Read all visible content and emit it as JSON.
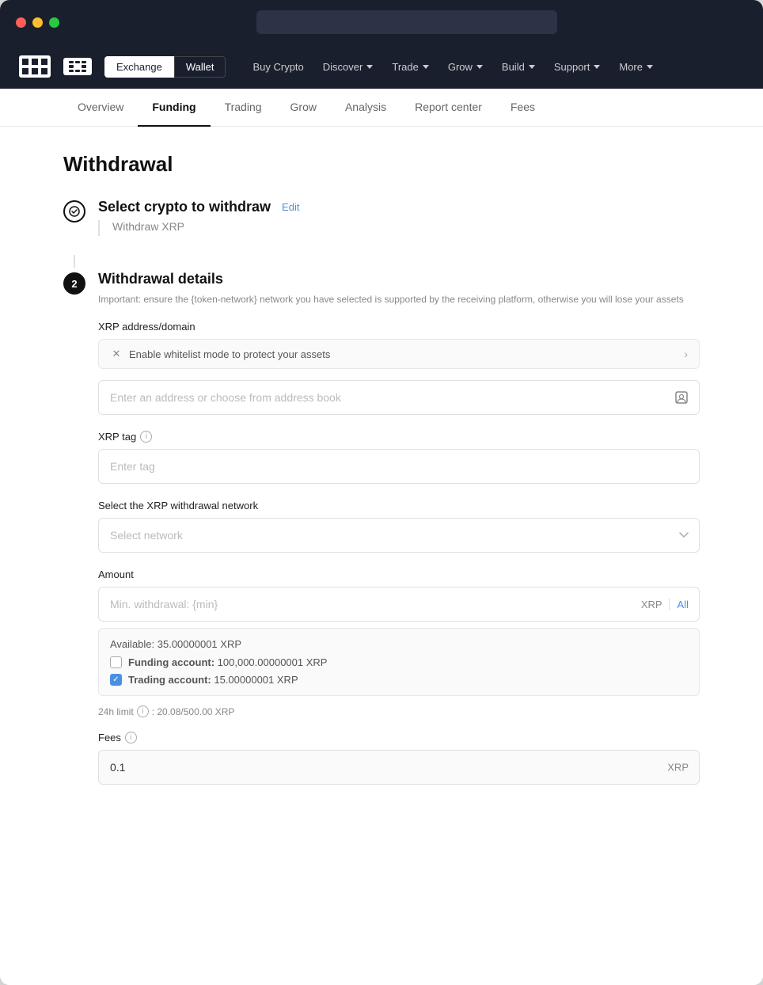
{
  "window": {
    "titlebar": {
      "dots": [
        "red",
        "yellow",
        "green"
      ]
    }
  },
  "topnav": {
    "logo": "OKX",
    "toggle": {
      "exchange_label": "Exchange",
      "wallet_label": "Wallet",
      "active": "exchange"
    },
    "links": [
      {
        "label": "Buy Crypto",
        "has_chevron": false
      },
      {
        "label": "Discover",
        "has_chevron": true
      },
      {
        "label": "Trade",
        "has_chevron": true
      },
      {
        "label": "Grow",
        "has_chevron": true
      },
      {
        "label": "Build",
        "has_chevron": true
      },
      {
        "label": "Support",
        "has_chevron": true
      },
      {
        "label": "More",
        "has_chevron": true
      }
    ]
  },
  "subnav": {
    "items": [
      {
        "label": "Overview",
        "active": false
      },
      {
        "label": "Funding",
        "active": true
      },
      {
        "label": "Trading",
        "active": false
      },
      {
        "label": "Grow",
        "active": false
      },
      {
        "label": "Analysis",
        "active": false
      },
      {
        "label": "Report center",
        "active": false
      },
      {
        "label": "Fees",
        "active": false
      }
    ]
  },
  "page": {
    "title": "Withdrawal",
    "step1": {
      "label": "Select crypto to withdraw",
      "edit_label": "Edit",
      "sub_label": "Withdraw XRP",
      "icon": "checkmark"
    },
    "step2": {
      "number": "2",
      "title": "Withdrawal details",
      "warning_text": "Important: ensure the {token-network} network you have selected is supported by the receiving platform, otherwise you will lose your assets",
      "xrp_address_label": "XRP address/domain",
      "whitelist_text": "Enable whitelist mode to protect your assets",
      "address_placeholder": "Enter an address or choose from address book",
      "xrp_tag_label": "XRP tag",
      "tag_placeholder": "Enter tag",
      "network_label": "Select the XRP withdrawal network",
      "network_placeholder": "Select network",
      "amount_label": "Amount",
      "amount_placeholder": "Min. withdrawal: {min}",
      "amount_currency": "XRP",
      "amount_all": "All",
      "available_text": "Available:  35.00000001 XRP",
      "funding_account_label": "Funding account:",
      "funding_account_value": "100,000.00000001 XRP",
      "trading_account_label": "Trading account:",
      "trading_account_value": "15.00000001 XRP",
      "limit_label": "24h limit",
      "limit_value": ": 20.08/500.00 XRP",
      "fees_label": "Fees",
      "fees_value": "0.1",
      "fees_currency": "XRP"
    }
  }
}
